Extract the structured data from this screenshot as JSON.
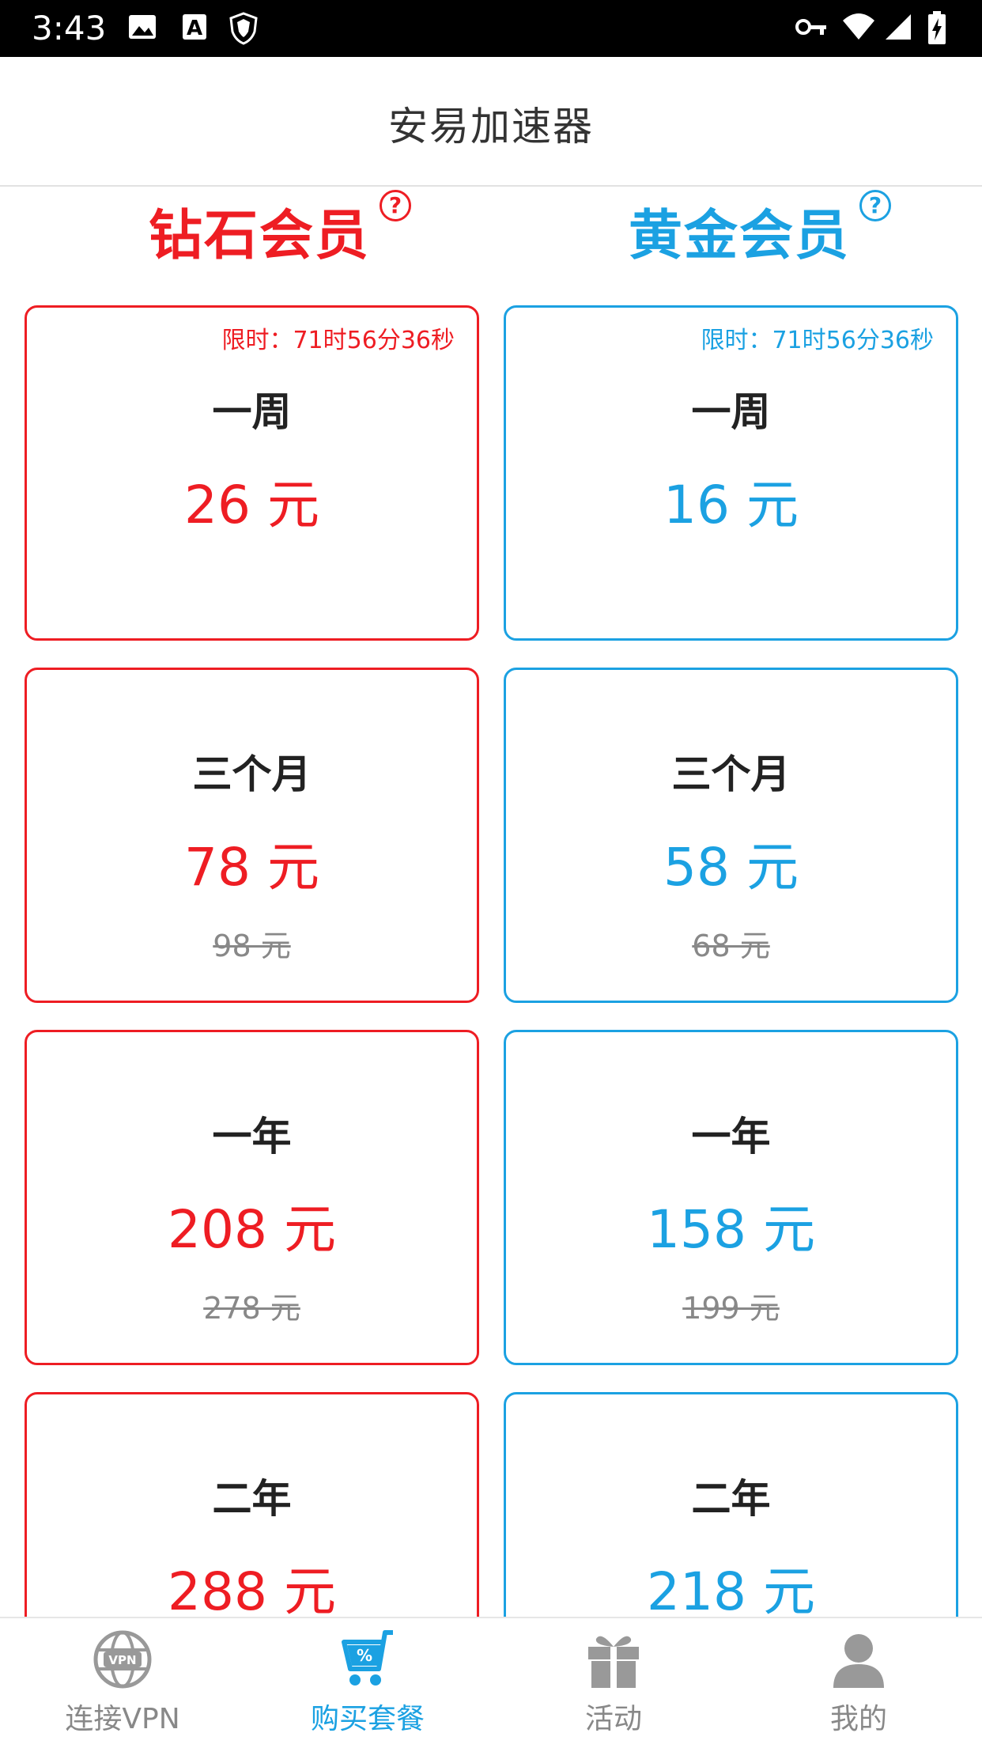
{
  "status_bar": {
    "time": "3:43",
    "icons": [
      "image-icon",
      "a-notification-icon",
      "shield-icon",
      "key-icon",
      "wifi-icon",
      "signal-icon",
      "battery-charging-icon"
    ]
  },
  "app_bar": {
    "title": "安易加速器"
  },
  "columns": [
    {
      "id": "diamond",
      "title": "钻石会员",
      "help_glyph": "?",
      "accent": "#ee1d23",
      "plans": [
        {
          "timer": "限时：71时56分36秒",
          "period": "一周",
          "price": "26 元",
          "original": ""
        },
        {
          "timer": "",
          "period": "三个月",
          "price": "78 元",
          "original": "98 元"
        },
        {
          "timer": "",
          "period": "一年",
          "price": "208 元",
          "original": "278 元"
        },
        {
          "timer": "",
          "period": "二年",
          "price": "288 元",
          "original": ""
        }
      ]
    },
    {
      "id": "gold",
      "title": "黄金会员",
      "help_glyph": "?",
      "accent": "#1ba1e2",
      "plans": [
        {
          "timer": "限时：71时56分36秒",
          "period": "一周",
          "price": "16 元",
          "original": ""
        },
        {
          "timer": "",
          "period": "三个月",
          "price": "58 元",
          "original": "68 元"
        },
        {
          "timer": "",
          "period": "一年",
          "price": "158 元",
          "original": "199 元"
        },
        {
          "timer": "",
          "period": "二年",
          "price": "218 元",
          "original": ""
        }
      ]
    }
  ],
  "tabs": [
    {
      "label": "连接VPN",
      "icon": "vpn-globe-icon",
      "active": false
    },
    {
      "label": "购买套餐",
      "icon": "shopping-cart-icon",
      "active": true
    },
    {
      "label": "活动",
      "icon": "gift-icon",
      "active": false
    },
    {
      "label": "我的",
      "icon": "profile-icon",
      "active": false
    }
  ],
  "colors": {
    "diamond": "#ee1d23",
    "gold": "#1ba1e2",
    "inactive_tab": "#888888"
  }
}
